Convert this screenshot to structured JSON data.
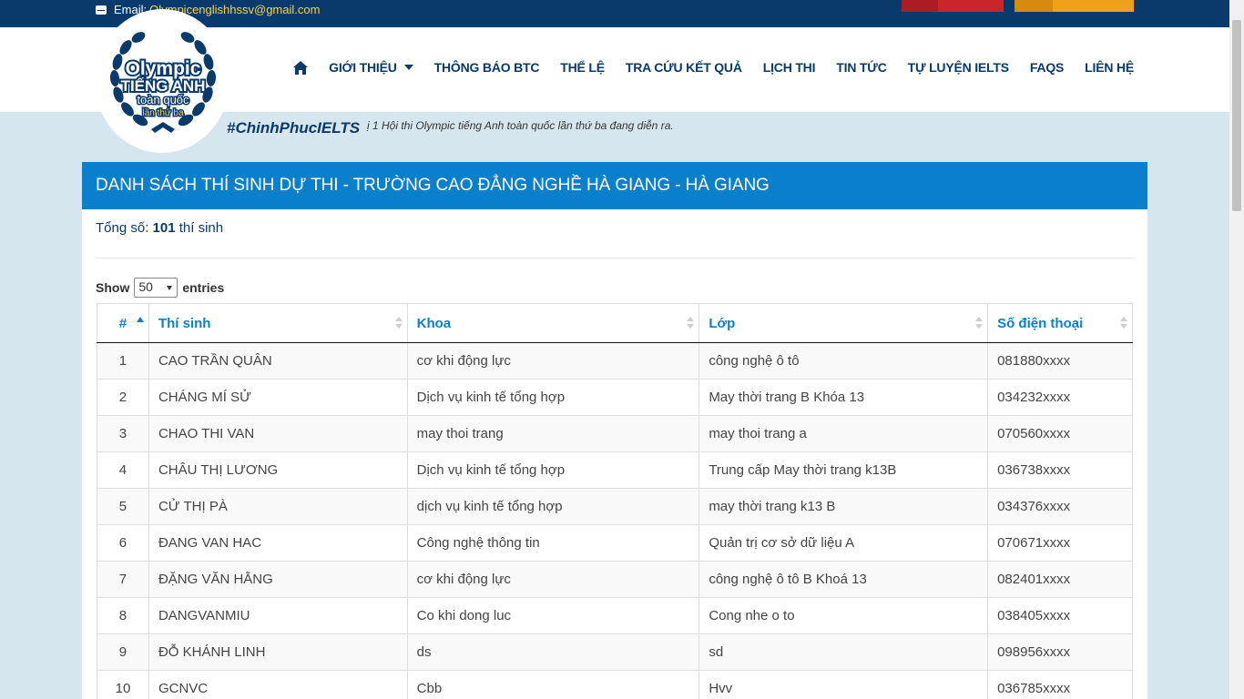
{
  "topbar": {
    "email_label": "Email:",
    "email": "Olympicenglishhssv@gmail.com"
  },
  "logo": {
    "line1": "Olympic",
    "line2": "TIẾNG ANH",
    "line3": "toàn quốc",
    "line4": "lần thứ ba"
  },
  "nav": {
    "items": [
      {
        "label": "GIỚI THIỆU"
      },
      {
        "label": "THÔNG BÁO BTC"
      },
      {
        "label": "THỂ LỆ"
      },
      {
        "label": "TRA CỨU KẾT QUẢ"
      },
      {
        "label": "LỊCH THI"
      },
      {
        "label": "TIN TỨC"
      },
      {
        "label": "TỰ LUYỆN IELTS"
      },
      {
        "label": "FAQS"
      },
      {
        "label": "LIÊN HỆ"
      }
    ]
  },
  "tagline": "#ChinhPhucIELTS",
  "marquee": "ị 1 Hội thi Olympic tiếng Anh toàn quốc lần thứ ba đang diễn ra.",
  "panel": {
    "title": "DANH SÁCH THÍ SINH DỰ THI - TRƯỜNG CAO ĐẲNG NGHỀ HÀ GIANG - HÀ GIANG",
    "total_label": "Tổng số:",
    "total_count": "101",
    "total_unit": "thí sinh",
    "show_label": "Show",
    "show_value": "50",
    "entries_label": "entries"
  },
  "table": {
    "headers": {
      "num": "#",
      "name": "Thí sinh",
      "khoa": "Khoa",
      "lop": "Lớp",
      "phone": "Số điện thoại"
    },
    "rows": [
      {
        "num": "1",
        "name": "CAO TRẦN QUÂN",
        "khoa": "cơ khi động lực",
        "lop": "công nghệ ô tô",
        "phone": "081880xxxx"
      },
      {
        "num": "2",
        "name": "CHÁNG MÍ SỬ",
        "khoa": "Dịch vụ kinh tế tổng hợp",
        "lop": "May thời trang B Khóa 13",
        "phone": "034232xxxx"
      },
      {
        "num": "3",
        "name": "CHAO THI VAN",
        "khoa": "may thoi trang",
        "lop": "may thoi trang a",
        "phone": "070560xxxx"
      },
      {
        "num": "4",
        "name": "CHÂU THỊ LƯƠNG",
        "khoa": "Dịch vụ kinh tế tổng hợp",
        "lop": "Trung cấp May thời trang k13B",
        "phone": "036738xxxx"
      },
      {
        "num": "5",
        "name": "CỬ THỊ PÀ",
        "khoa": "dịch vụ kinh tế tổng hợp",
        "lop": "may thời trang k13 B",
        "phone": "034376xxxx"
      },
      {
        "num": "6",
        "name": "ĐANG VAN HAC",
        "khoa": "Công nghệ thông tin",
        "lop": "Quản trị cơ sở dữ liệu A",
        "phone": "070671xxxx"
      },
      {
        "num": "7",
        "name": "ĐẶNG VĂN HẰNG",
        "khoa": "cơ khi động lực",
        "lop": "công nghệ ô tô B Khoá 13",
        "phone": "082401xxxx"
      },
      {
        "num": "8",
        "name": "DANGVANMIU",
        "khoa": "Co khi dong luc",
        "lop": "Cong nhe o to",
        "phone": "038405xxxx"
      },
      {
        "num": "9",
        "name": "ĐỖ KHÁNH LINH",
        "khoa": "ds",
        "lop": "sd",
        "phone": "098956xxxx"
      },
      {
        "num": "10",
        "name": "GCNVC",
        "khoa": "Cbb",
        "lop": "Hvv",
        "phone": "036785xxxx"
      }
    ]
  },
  "colors": {
    "navy": "#0a3a6b",
    "blue": "#0a7fcb",
    "yellow": "#f6d34b"
  }
}
